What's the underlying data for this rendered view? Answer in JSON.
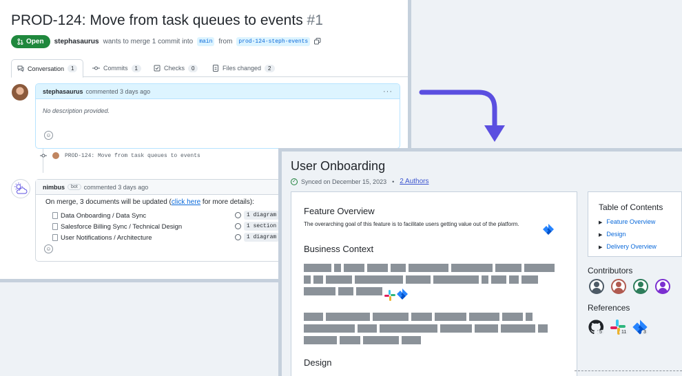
{
  "pr": {
    "title": "PROD-124: Move from task queues to events",
    "number": "#1",
    "status": "Open",
    "author": "stephasaurus",
    "merge_text": "wants to merge 1 commit into",
    "base_branch": "main",
    "from_text": "from",
    "head_branch": "prod-124-steph-events",
    "tabs": [
      {
        "label": "Conversation",
        "count": "1"
      },
      {
        "label": "Commits",
        "count": "1"
      },
      {
        "label": "Checks",
        "count": "0"
      },
      {
        "label": "Files changed",
        "count": "2"
      }
    ],
    "comment1": {
      "author": "stephasaurus",
      "meta": "commented 3 days ago",
      "body": "No description provided."
    },
    "commit_msg": "PROD-124: Move from task queues to events",
    "comment2": {
      "author": "nimbus",
      "bot_tag": "bot",
      "meta": "commented 3 days ago",
      "text_before": "On merge, 3 documents will be updated (",
      "link": "click here",
      "text_after": " for more details):",
      "docs": [
        {
          "name": "Data Onboarding / Data Sync",
          "tag": "1 diagram"
        },
        {
          "name": "Salesforce Billing Sync / Technical Design",
          "tag": "1 section"
        },
        {
          "name": "User Notifications / Architecture",
          "tag": "1 diagram"
        }
      ]
    }
  },
  "doc": {
    "title": "User Onboarding",
    "synced": "Synced on December 15, 2023",
    "sep": "•",
    "authors": "2 Authors",
    "section1": "Feature Overview",
    "overview_text": "The overarching goal of this feature is to facilitate users getting value out of the platform.",
    "section2": "Business Context",
    "section3": "Design",
    "toc_title": "Table of Contents",
    "toc": [
      "Feature Overview",
      "Design",
      "Delivery Overview"
    ],
    "contributors_title": "Contributors",
    "references_title": "References",
    "references": [
      {
        "icon": "github-icon",
        "count": "5"
      },
      {
        "icon": "slack-icon",
        "count": "11"
      },
      {
        "icon": "jira-icon",
        "count": "3"
      }
    ]
  },
  "colors": {
    "open_green": "#1f883d",
    "link_blue": "#0969da",
    "arrow_purple": "#5b4fe0",
    "redacted_gray": "#8b9299",
    "contributors": [
      "#4d5a66",
      "#b05a50",
      "#2e7d5b",
      "#7b2fd0"
    ]
  }
}
